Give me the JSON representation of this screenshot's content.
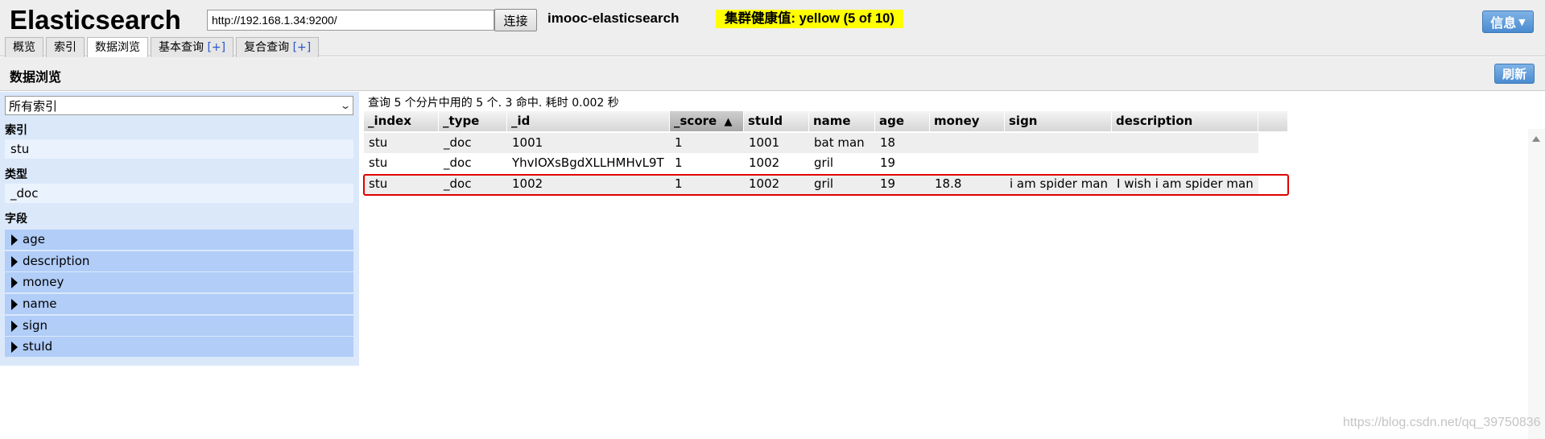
{
  "header": {
    "app_title": "Elasticsearch",
    "url_value": "http://192.168.1.34:9200/",
    "connect_label": "连接",
    "cluster_name": "imooc-elasticsearch",
    "health_text": "集群健康值: yellow (5 of 10)",
    "health_color": "#ffff00",
    "info_label": "信息",
    "info_icon": "caret-down-icon"
  },
  "tabs": [
    {
      "label": "概览",
      "plus": ""
    },
    {
      "label": "索引",
      "plus": ""
    },
    {
      "label": "数据浏览",
      "plus": ""
    },
    {
      "label": "基本查询",
      "plus": "[+]"
    },
    {
      "label": "复合查询",
      "plus": "[+]"
    }
  ],
  "section": {
    "title": "数据浏览",
    "refresh_label": "刷新"
  },
  "sidebar": {
    "index_select_value": "所有索引",
    "index_heading": "索引",
    "index_items": [
      "stu"
    ],
    "type_heading": "类型",
    "type_items": [
      "_doc"
    ],
    "fields_heading": "字段",
    "fields": [
      "age",
      "description",
      "money",
      "name",
      "sign",
      "stuId"
    ]
  },
  "results": {
    "summary": "查询 5 个分片中用的 5 个. 3 命中. 耗时 0.002 秒",
    "columns": [
      "_index",
      "_type",
      "_id",
      "_score",
      "stuId",
      "name",
      "age",
      "money",
      "sign",
      "description"
    ],
    "sorted_column": "_score",
    "sort_indicator": "▲",
    "rows": [
      [
        "stu",
        "_doc",
        "1001",
        "1",
        "1001",
        "bat man",
        "18",
        "",
        "",
        ""
      ],
      [
        "stu",
        "_doc",
        "YhvIOXsBgdXLLHMHvL9T",
        "1",
        "1002",
        "gril",
        "19",
        "",
        "",
        ""
      ],
      [
        "stu",
        "_doc",
        "1002",
        "1",
        "1002",
        "gril",
        "19",
        "18.8",
        "i am spider man",
        "I wish i am spider man"
      ]
    ],
    "highlighted_row": 2,
    "highlight_color": "#e00000"
  },
  "watermark": "https://blog.csdn.net/qq_39750836"
}
